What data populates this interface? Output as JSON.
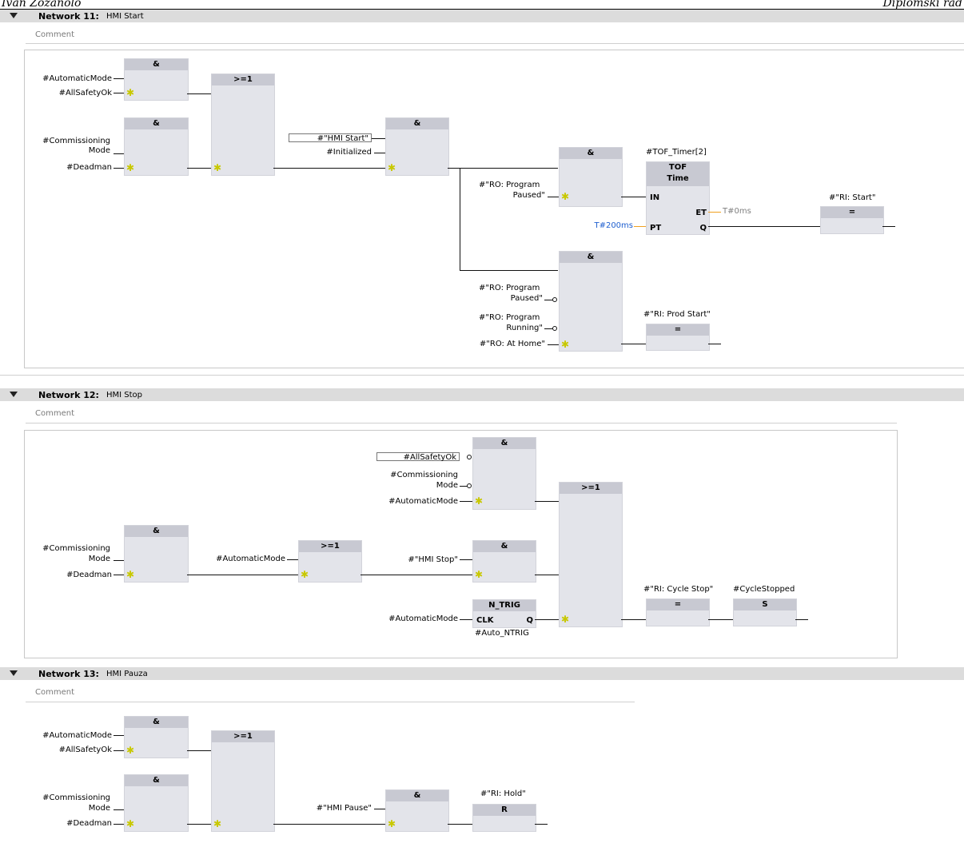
{
  "doc_header": {
    "left": "Ivan Zozanolo",
    "right": "Diplomski rad"
  },
  "networks": [
    {
      "title": "Network 11:",
      "name": "HMI Start",
      "comment": "Comment"
    },
    {
      "title": "Network 12:",
      "name": "HMI Stop",
      "comment": "Comment"
    },
    {
      "title": "Network 13:",
      "name": "HMI Pauza",
      "comment": "Comment"
    }
  ],
  "ops": {
    "and": "&",
    "or": ">=1",
    "assign": "=",
    "set": "S",
    "reset": "R"
  },
  "n11": {
    "automatic_mode": "#AutomaticMode",
    "all_safety_ok": "#AllSafetyOk",
    "commissioning": "#Commissioning",
    "mode": "Mode",
    "deadman": "#Deadman",
    "hmi_start": "#\"HMI Start\"",
    "initialized": "#Initialized",
    "ro_program_1": "#\"RO: Program",
    "paused_1": "Paused\"",
    "timer_name": "#TOF_Timer[2]",
    "tof": "TOF",
    "time": "Time",
    "in": "IN",
    "et": "ET",
    "et_value": "T#0ms",
    "pt": "PT",
    "q": "Q",
    "pt_value": "T#200ms",
    "ri_start": "#\"RI: Start\"",
    "ro_program_2": "#\"RO: Program",
    "paused_2": "Paused\"",
    "ro_program_3": "#\"RO: Program",
    "running": "Running\"",
    "ro_at_home": "#\"RO: At Home\"",
    "ri_prod_start": "#\"RI: Prod Start\""
  },
  "n12": {
    "all_safety_ok": "#AllSafetyOk",
    "commissioning_1": "#Commissioning",
    "mode_1": "Mode",
    "automatic_mode_1": "#AutomaticMode",
    "commissioning_2": "#Commissioning",
    "mode_2": "Mode",
    "deadman": "#Deadman",
    "automatic_mode_2": "#AutomaticMode",
    "hmi_stop": "#\"HMI Stop\"",
    "ntrig": "N_TRIG",
    "clk": "CLK",
    "q": "Q",
    "automatic_mode_3": "#AutomaticMode",
    "auto_ntrig": "#Auto_NTRIG",
    "ri_cycle_stop": "#\"RI: Cycle Stop\"",
    "cycle_stopped": "#CycleStopped"
  },
  "n13": {
    "automatic_mode": "#AutomaticMode",
    "all_safety_ok": "#AllSafetyOk",
    "commissioning": "#Commissioning",
    "mode": "Mode",
    "deadman": "#Deadman",
    "hmi_pause": "#\"HMI Pause\"",
    "ri_hold": "#\"RI: Hold\""
  }
}
